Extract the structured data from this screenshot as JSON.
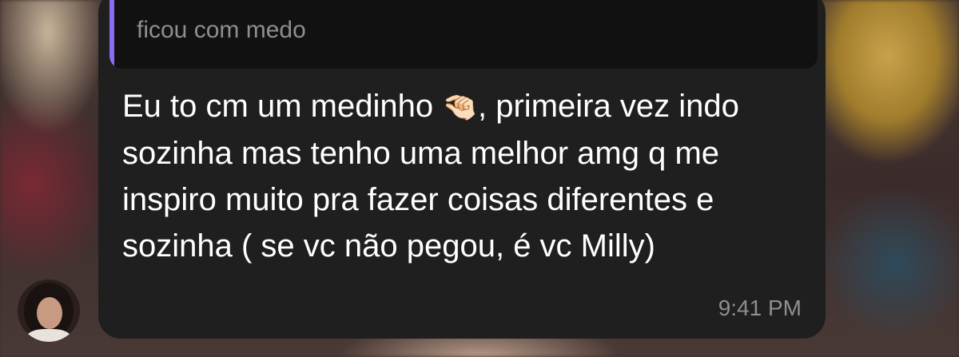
{
  "reply": {
    "text": "ficou com medo",
    "accent_color": "#8a6cf0"
  },
  "message": {
    "text_before_emoji": "Eu to cm um medinho ",
    "emoji": "🤏🏻",
    "text_after_emoji": ", primeira vez indo sozinha mas tenho uma melhor amg q me inspiro muito pra fazer coisas diferentes e sozinha ( se vc não pegou, é vc Milly)",
    "timestamp": "9:41 PM"
  },
  "avatar": {
    "icon": "profile-photo"
  }
}
